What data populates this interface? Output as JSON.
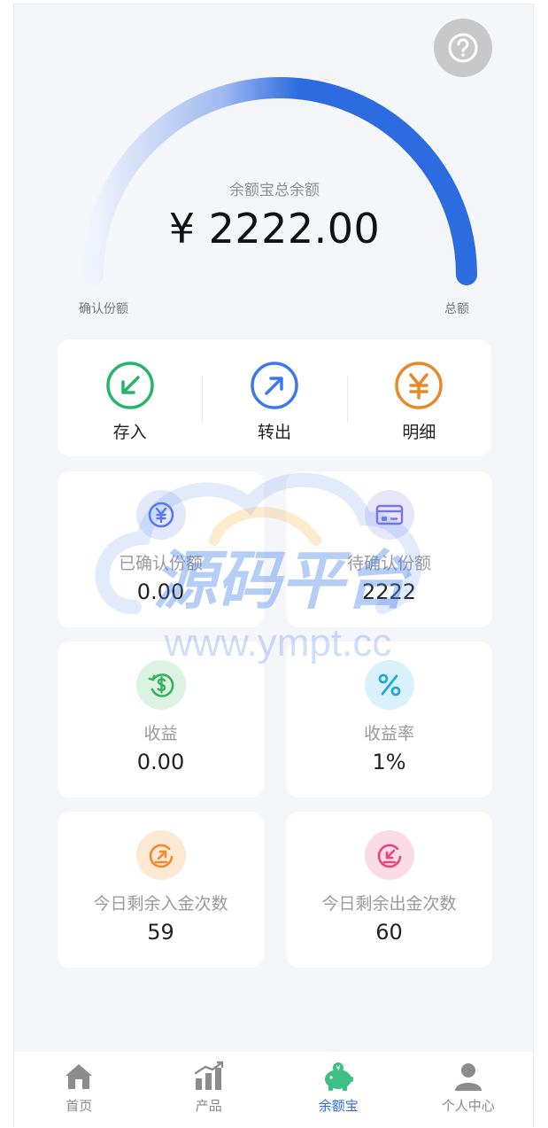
{
  "gauge": {
    "title": "余额宝总余额",
    "amount": "¥ 2222.00",
    "left_label": "确认份额",
    "right_label": "总额",
    "colors": {
      "start": "#e9eefb",
      "end": "#2c6be0"
    }
  },
  "actions": [
    {
      "label": "存入",
      "icon": "arrow-down-left-icon",
      "color": "#27b36a"
    },
    {
      "label": "转出",
      "icon": "arrow-up-right-icon",
      "color": "#3e78ee"
    },
    {
      "label": "明细",
      "icon": "yen-icon",
      "color": "#e6892a"
    }
  ],
  "cards": [
    {
      "label": "已确认份额",
      "value": "0.00",
      "icon": "yen-coin-icon",
      "color": "#5b73f0",
      "bg": "#e3e8fd"
    },
    {
      "label": "待确认份额",
      "value": "2222",
      "icon": "card-lock-icon",
      "color": "#7a74e6",
      "bg": "#e7e6fb"
    },
    {
      "label": "收益",
      "value": "0.00",
      "icon": "dollar-cycle-icon",
      "color": "#36b25a",
      "bg": "#dcf2e3"
    },
    {
      "label": "收益率",
      "value": "1%",
      "icon": "percent-icon",
      "color": "#27a8d8",
      "bg": "#d8f1fa"
    },
    {
      "label": "今日剩余入金次数",
      "value": "59",
      "icon": "deposit-cycle-icon",
      "color": "#ef8b2a",
      "bg": "#fde8d4"
    },
    {
      "label": "今日剩余出金次数",
      "value": "60",
      "icon": "withdraw-cycle-icon",
      "color": "#e8457c",
      "bg": "#fbdbe6"
    }
  ],
  "watermark": {
    "text": "源码平台",
    "url": "www.ympt.cc"
  },
  "tabbar": [
    {
      "label": "首页",
      "icon": "home-icon",
      "active": false
    },
    {
      "label": "产品",
      "icon": "chart-icon",
      "active": false
    },
    {
      "label": "余额宝",
      "icon": "piggy-bank-icon",
      "active": true
    },
    {
      "label": "个人中心",
      "icon": "user-icon",
      "active": false
    }
  ]
}
